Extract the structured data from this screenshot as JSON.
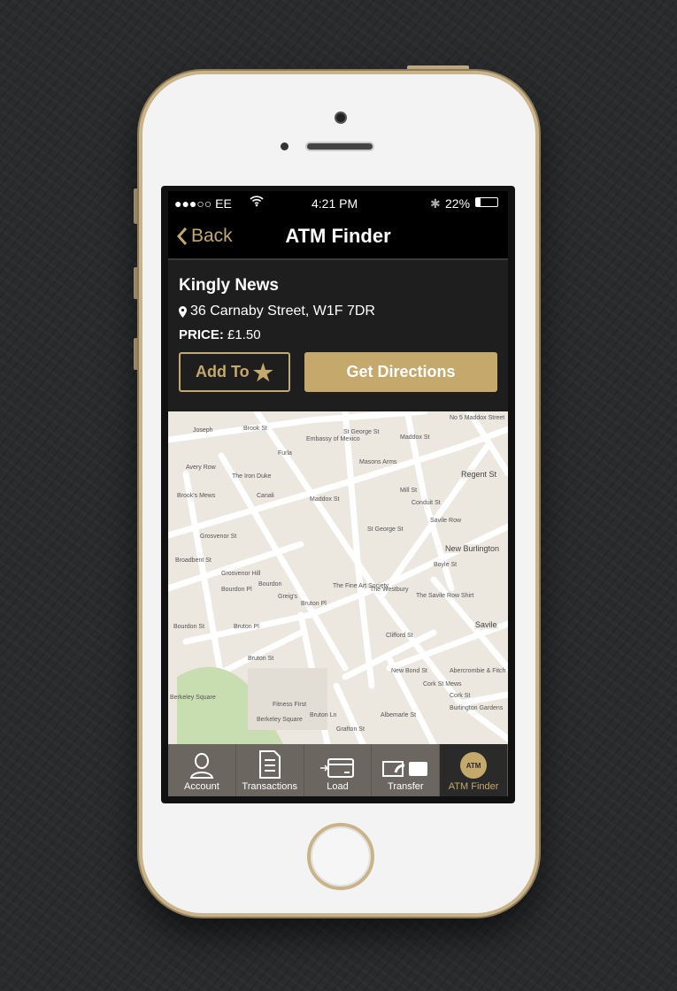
{
  "status": {
    "carrier": "●●●○○ EE",
    "time": "4:21 PM",
    "battery": "22%",
    "battery_level": 0.22
  },
  "nav": {
    "back": "Back",
    "title": "ATM Finder"
  },
  "location": {
    "name": "Kingly News",
    "address": "36 Carnaby Street, W1F 7DR",
    "price_label": "PRICE:",
    "price": "£1.50"
  },
  "actions": {
    "add_to": "Add To",
    "directions": "Get Directions"
  },
  "map": {
    "labels": [
      "Joseph",
      "Brook St",
      "Embassy of Mexico",
      "St George St",
      "Maddox St",
      "No 5 Maddox Street",
      "Furla",
      "Avery Row",
      "The Iron Duke",
      "Masons Arms",
      "Brook's Mews",
      "Canali",
      "Maddox St",
      "Mill St",
      "Conduit St",
      "Regent St",
      "Grosvenor St",
      "St George St",
      "Savile Row",
      "New Burlington",
      "Boyle St",
      "Broadbent St",
      "Grosvenor Hill",
      "Bourdon Pl",
      "Bourdon",
      "The Fine Art Society",
      "The Westbury",
      "The Savile Row Shirt",
      "Greig's",
      "Bruton Pl",
      "Bourdon St",
      "Bruton Pl",
      "Clifford St",
      "Savile",
      "Bruton St",
      "Abercrombie & Fitch",
      "New Bond St",
      "Cork St Mews",
      "Cork St",
      "Burlington Gardens",
      "Fitness First",
      "Berkeley Square",
      "Bruton Ln",
      "Albemarle St",
      "Grafton St",
      "Berkeley Square"
    ]
  },
  "tabs": [
    {
      "label": "Account",
      "icon": "person-icon"
    },
    {
      "label": "Transactions",
      "icon": "document-list-icon"
    },
    {
      "label": "Load",
      "icon": "card-icon"
    },
    {
      "label": "Transfer",
      "icon": "transfer-wallet-icon"
    },
    {
      "label": "ATM Finder",
      "icon": "atm-icon",
      "badge": "ATM",
      "active": true
    }
  ],
  "colors": {
    "accent": "#c5a86b",
    "nav": "#000000",
    "panel": "#1e1e1e",
    "tabbar": "#6b6760"
  }
}
